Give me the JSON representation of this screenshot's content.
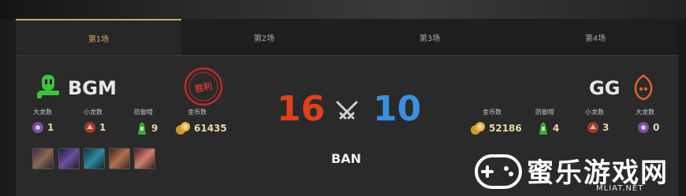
{
  "tabs": [
    {
      "label": "第1场",
      "active": true
    },
    {
      "label": "第2场",
      "active": false
    },
    {
      "label": "第3场",
      "active": false
    },
    {
      "label": "第4场",
      "active": false
    }
  ],
  "left_team": {
    "name": "BGM",
    "win_stamp": "胜利",
    "stats": [
      {
        "label": "大龙数",
        "value": "1",
        "icon": "baron-icon"
      },
      {
        "label": "小龙数",
        "value": "1",
        "icon": "dragon-icon"
      },
      {
        "label": "防御塔",
        "value": "9",
        "icon": "tower-icon"
      },
      {
        "label": "金币数",
        "value": "61435",
        "icon": "gold-icon"
      }
    ],
    "bans": [
      "champion-ban-1",
      "champion-ban-2",
      "champion-ban-3",
      "champion-ban-4",
      "champion-ban-5"
    ]
  },
  "right_team": {
    "name": "GG",
    "stats": [
      {
        "label": "金币数",
        "value": "52186",
        "icon": "gold-icon"
      },
      {
        "label": "防御塔",
        "value": "4",
        "icon": "tower-icon"
      },
      {
        "label": "小龙数",
        "value": "3",
        "icon": "dragon-icon"
      },
      {
        "label": "大龙数",
        "value": "0",
        "icon": "baron-icon"
      }
    ]
  },
  "score": {
    "left": "16",
    "right": "10"
  },
  "ban_label": "BAN",
  "watermark": {
    "text": "蜜乐游戏网",
    "sub": "MLIAT.NET"
  },
  "colors": {
    "accent": "#d7a85a",
    "left_score": "#e0401c",
    "right_score": "#3b8fe0",
    "stamp": "#c0282a"
  }
}
